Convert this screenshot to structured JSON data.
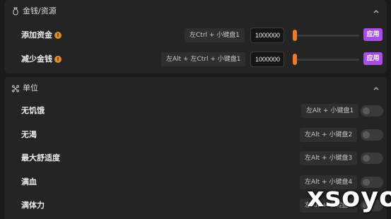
{
  "sections": [
    {
      "title": "金钱/资源",
      "icon": "money-bag-icon",
      "rows": [
        {
          "label": "添加资金",
          "hotkey": "左Ctrl + 小键盘1",
          "value": "1000000",
          "slider_fraction": 0.0,
          "apply_label": "应用"
        },
        {
          "label": "减少金钱",
          "hotkey": "左Alt + 左Ctrl + 小键盘1",
          "value": "1000000",
          "slider_fraction": 0.0,
          "apply_label": "应用"
        }
      ]
    },
    {
      "title": "单位",
      "icon": "unit-nodes-icon",
      "rows": [
        {
          "label": "无饥饿",
          "hotkey": "左Alt + 小键盘1",
          "enabled": false
        },
        {
          "label": "无渴",
          "hotkey": "左Alt + 小键盘2",
          "enabled": false
        },
        {
          "label": "最大舒适度",
          "hotkey": "左Alt + 小键盘3",
          "enabled": false
        },
        {
          "label": "满血",
          "hotkey": "左Alt + 小键盘4",
          "enabled": false
        },
        {
          "label": "满体力",
          "hotkey": "左Alt + 小键盘5",
          "enabled": false
        }
      ]
    }
  ],
  "info_glyph": "!",
  "watermark": "xsoyo",
  "colors": {
    "accent_apply": "#a64fe0",
    "slider_thumb": "#ef7a2a",
    "info_badge": "#e28a2b",
    "panel_bg": "#242424",
    "page_bg": "#1a1a1a"
  }
}
